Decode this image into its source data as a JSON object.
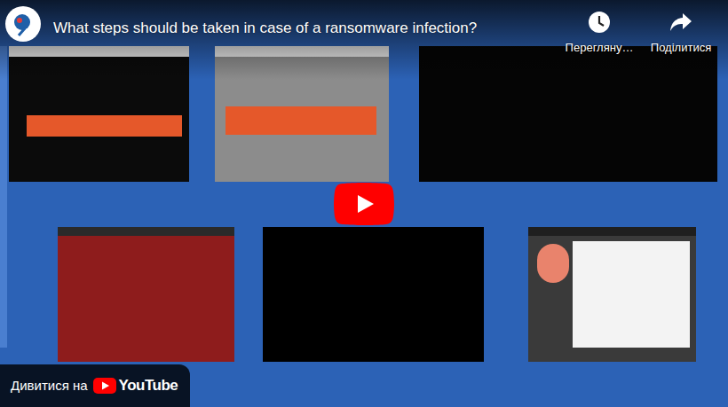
{
  "player": {
    "title": "What steps should be taken in case of a ransomware infection?",
    "actions": [
      {
        "kind": "watch-later",
        "label": "Перегляну…"
      },
      {
        "kind": "share",
        "label": "Поділитися"
      }
    ],
    "watch_on": {
      "label": "Дивитися на",
      "brand": "YouTube"
    }
  }
}
